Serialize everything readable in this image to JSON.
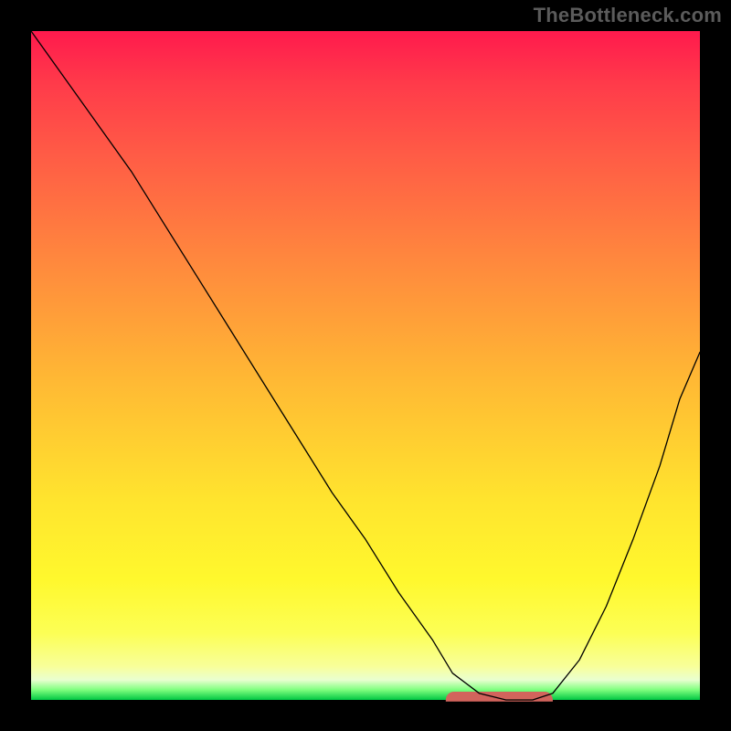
{
  "attribution": "TheBottleneck.com",
  "chart_data": {
    "type": "line",
    "title": "",
    "xlabel": "",
    "ylabel": "",
    "xlim": [
      0,
      100
    ],
    "ylim": [
      0,
      100
    ],
    "grid": false,
    "series": [
      {
        "name": "bottleneck-curve",
        "x": [
          0,
          5,
          10,
          15,
          20,
          25,
          30,
          35,
          40,
          45,
          50,
          55,
          60,
          63,
          67,
          71,
          75,
          78,
          82,
          86,
          90,
          94,
          97,
          100
        ],
        "values": [
          100,
          93,
          86,
          79,
          71,
          63,
          55,
          47,
          39,
          31,
          24,
          16,
          9,
          4,
          1,
          0,
          0,
          1,
          6,
          14,
          24,
          35,
          45,
          52
        ]
      }
    ],
    "annotations": [
      {
        "name": "optimal-range-marker",
        "shape": "rounded-bar",
        "color": "#d2645c",
        "x_start": 62,
        "x_end": 78,
        "y": 0
      }
    ],
    "background_gradient": {
      "top": "#ff1a4d",
      "mid": "#ffe42e",
      "bottom": "#00c743"
    }
  }
}
